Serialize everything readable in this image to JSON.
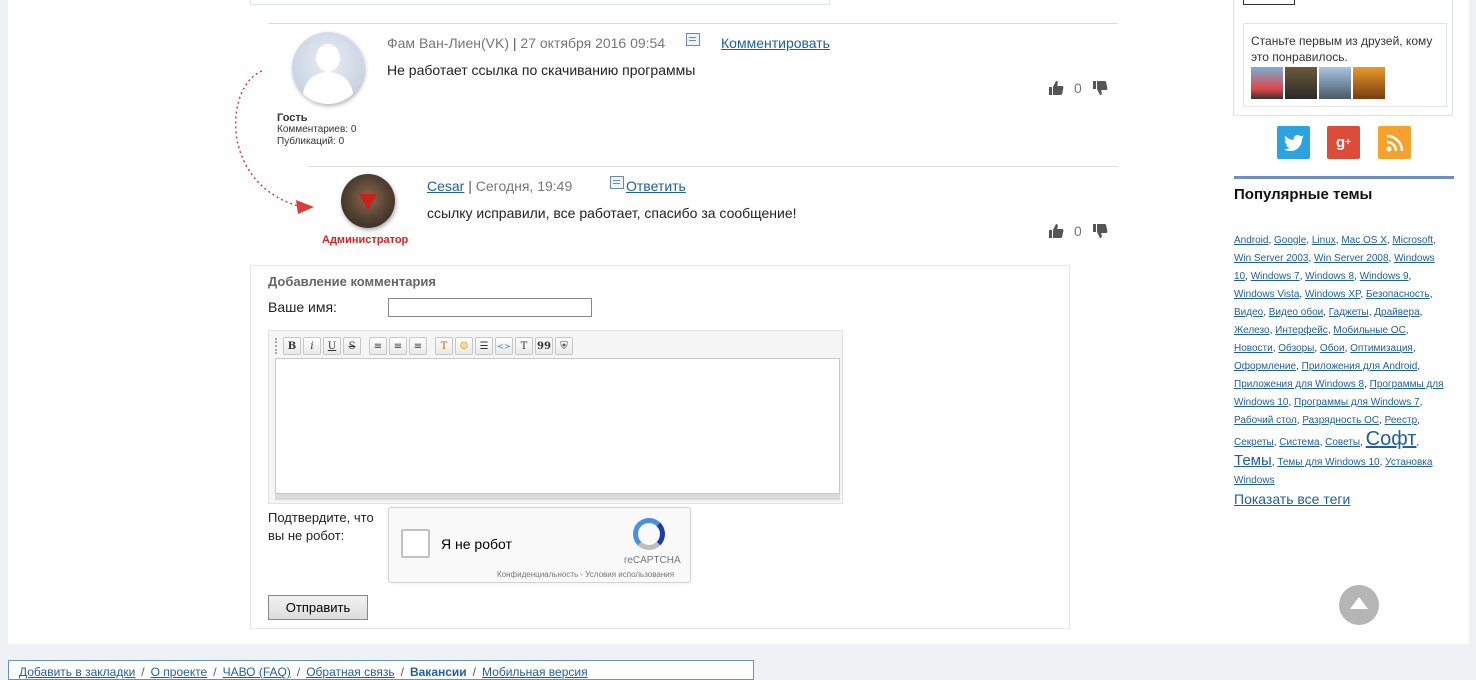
{
  "comments": [
    {
      "author": "Фам Ван-Лиен(VK)",
      "date": "27 октября 2016 09:54",
      "action": "Комментировать",
      "text": "Не работает ссылка по скачиванию программы",
      "role": "Гость",
      "stats_comments": "Комментариев: 0",
      "stats_posts": "Публикаций: 0",
      "votes": "0"
    },
    {
      "author": "Cesar",
      "date": "Сегодня, 19:49",
      "action": "Ответить",
      "text": "ссылку исправили, все работает, спасибо за сообщение!",
      "role": "Администратор",
      "votes": "0"
    }
  ],
  "form": {
    "title": "Добавление комментария",
    "name_label": "Ваше имя:",
    "name_value": "",
    "toolbar": [
      "B",
      "i",
      "U",
      "S",
      "≡",
      "≡",
      "≡",
      "T",
      "☺",
      "☰",
      "<>",
      "T",
      "99",
      "⛨"
    ],
    "captcha_label": "Подтвердите, что вы не робот:",
    "captcha_text": "Я не робот",
    "captcha_brand": "reCAPTCHA",
    "captcha_privacy": "Конфиденциальность - Условия использования",
    "submit": "Отправить"
  },
  "sidebar": {
    "vk_text": "Станьте первым из друзей, кому это понравилось.",
    "social": [
      "twitter-icon",
      "google-plus-icon",
      "rss-icon"
    ],
    "popular_title": "Популярные темы",
    "tags": [
      {
        "t": "Android",
        "s": "n"
      },
      {
        "t": "Google",
        "s": "n"
      },
      {
        "t": "Linux",
        "s": "n"
      },
      {
        "t": "Mac OS X",
        "s": "n"
      },
      {
        "t": "Microsoft",
        "s": "n"
      },
      {
        "t": "Win Server 2003",
        "s": "n"
      },
      {
        "t": "Win Server 2008",
        "s": "n"
      },
      {
        "t": "Windows 10",
        "s": "n"
      },
      {
        "t": "Windows 7",
        "s": "n"
      },
      {
        "t": "Windows 8",
        "s": "n"
      },
      {
        "t": "Windows 9",
        "s": "n"
      },
      {
        "t": "Windows Vista",
        "s": "n"
      },
      {
        "t": "Windows XP",
        "s": "n"
      },
      {
        "t": "Безопасность",
        "s": "n"
      },
      {
        "t": "Видео",
        "s": "n"
      },
      {
        "t": "Видео обои",
        "s": "n"
      },
      {
        "t": "Гаджеты",
        "s": "n"
      },
      {
        "t": "Драйвера",
        "s": "n"
      },
      {
        "t": "Железо",
        "s": "n"
      },
      {
        "t": "Интерфейс",
        "s": "n"
      },
      {
        "t": "Мобильные ОС",
        "s": "n"
      },
      {
        "t": "Новости",
        "s": "n"
      },
      {
        "t": "Обзоры",
        "s": "n"
      },
      {
        "t": "Обои",
        "s": "n"
      },
      {
        "t": "Оптимизация",
        "s": "n"
      },
      {
        "t": "Оформление",
        "s": "n"
      },
      {
        "t": "Приложения для Android",
        "s": "n"
      },
      {
        "t": "Приложения для Windows 8",
        "s": "n"
      },
      {
        "t": "Программы для Windows 10",
        "s": "n"
      },
      {
        "t": "Программы для Windows 7",
        "s": "n"
      },
      {
        "t": "Рабочий стол",
        "s": "n"
      },
      {
        "t": "Разрядность ОС",
        "s": "n"
      },
      {
        "t": "Реестр",
        "s": "n"
      },
      {
        "t": "Секреты",
        "s": "n"
      },
      {
        "t": "Система",
        "s": "n"
      },
      {
        "t": "Советы",
        "s": "n"
      },
      {
        "t": "Софт",
        "s": "big"
      },
      {
        "t": "Темы",
        "s": "med"
      },
      {
        "t": "Темы для Windows 10",
        "s": "n"
      },
      {
        "t": "Установка Windows",
        "s": "n"
      }
    ],
    "show_all": "Показать все теги"
  },
  "footer": {
    "links": [
      "Добавить в закладки",
      "О проекте",
      "ЧАВО (FAQ)",
      "Обратная связь",
      "Вакансии",
      "Мобильная версия"
    ],
    "bold_index": 4
  }
}
